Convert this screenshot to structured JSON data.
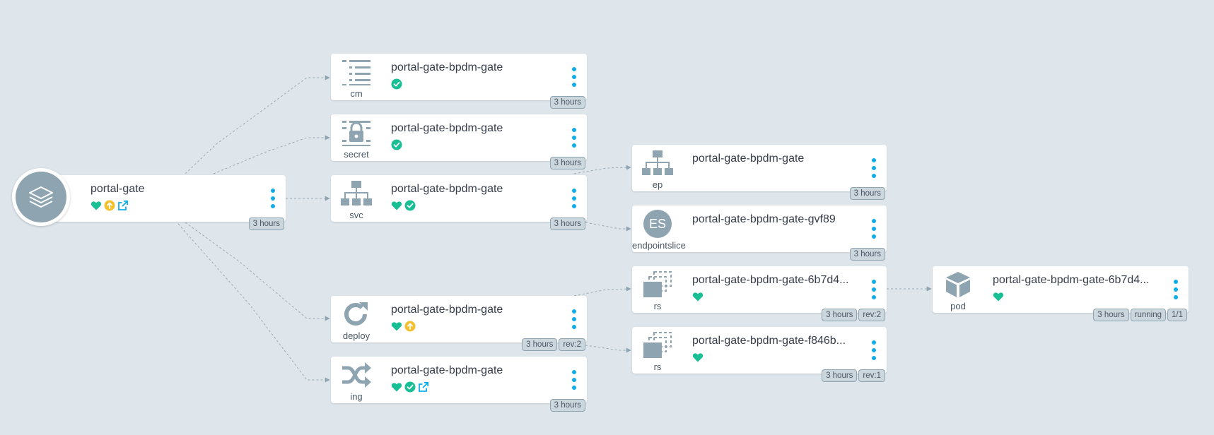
{
  "colors": {
    "healthy": "#18be94",
    "synced": "#18be94",
    "progressing": "#f4c030",
    "link": "#0dadea",
    "icon": "#8fa4b1"
  },
  "app": {
    "name": "portal-gate",
    "kind_icon": "layers-icon",
    "status_icons": [
      "heart-icon",
      "arrow-up-circle-icon",
      "external-link-icon"
    ],
    "tags": [
      "3 hours"
    ]
  },
  "nodes": [
    {
      "id": "cm",
      "name": "portal-gate-bpdm-gate",
      "kind": "cm",
      "icon": "list-icon",
      "status_icons": [
        "check-circle-icon"
      ],
      "tags": [
        "3 hours"
      ]
    },
    {
      "id": "secret",
      "name": "portal-gate-bpdm-gate",
      "kind": "secret",
      "icon": "lock-icon",
      "status_icons": [
        "check-circle-icon"
      ],
      "tags": [
        "3 hours"
      ]
    },
    {
      "id": "svc",
      "name": "portal-gate-bpdm-gate",
      "kind": "svc",
      "icon": "sitemap-icon",
      "status_icons": [
        "heart-icon",
        "check-circle-icon"
      ],
      "tags": [
        "3 hours"
      ]
    },
    {
      "id": "deploy",
      "name": "portal-gate-bpdm-gate",
      "kind": "deploy",
      "icon": "redo-icon",
      "status_icons": [
        "heart-icon",
        "arrow-up-circle-icon"
      ],
      "tags": [
        "3 hours",
        "rev:2"
      ]
    },
    {
      "id": "ing",
      "name": "portal-gate-bpdm-gate",
      "kind": "ing",
      "icon": "random-icon",
      "status_icons": [
        "heart-icon",
        "check-circle-icon",
        "external-link-icon"
      ],
      "tags": [
        "3 hours"
      ]
    },
    {
      "id": "ep",
      "name": "portal-gate-bpdm-gate",
      "kind": "ep",
      "icon": "sitemap-icon",
      "status_icons": [],
      "tags": [
        "3 hours"
      ]
    },
    {
      "id": "es",
      "name": "portal-gate-bpdm-gate-gvf89",
      "kind": "endpointslice",
      "icon": "es-badge-icon",
      "icon_text": "ES",
      "status_icons": [],
      "tags": [
        "3 hours"
      ]
    },
    {
      "id": "rs1",
      "name": "portal-gate-bpdm-gate-6b7d4...",
      "kind": "rs",
      "icon": "clone-icon",
      "status_icons": [
        "heart-icon"
      ],
      "tags": [
        "3 hours",
        "rev:2"
      ]
    },
    {
      "id": "rs2",
      "name": "portal-gate-bpdm-gate-f846b...",
      "kind": "rs",
      "icon": "clone-icon",
      "status_icons": [
        "heart-icon"
      ],
      "tags": [
        "3 hours",
        "rev:1"
      ]
    },
    {
      "id": "pod",
      "name": "portal-gate-bpdm-gate-6b7d4...",
      "kind": "pod",
      "icon": "cube-icon",
      "status_icons": [
        "heart-icon"
      ],
      "tags": [
        "3 hours",
        "running",
        "1/1"
      ]
    }
  ]
}
